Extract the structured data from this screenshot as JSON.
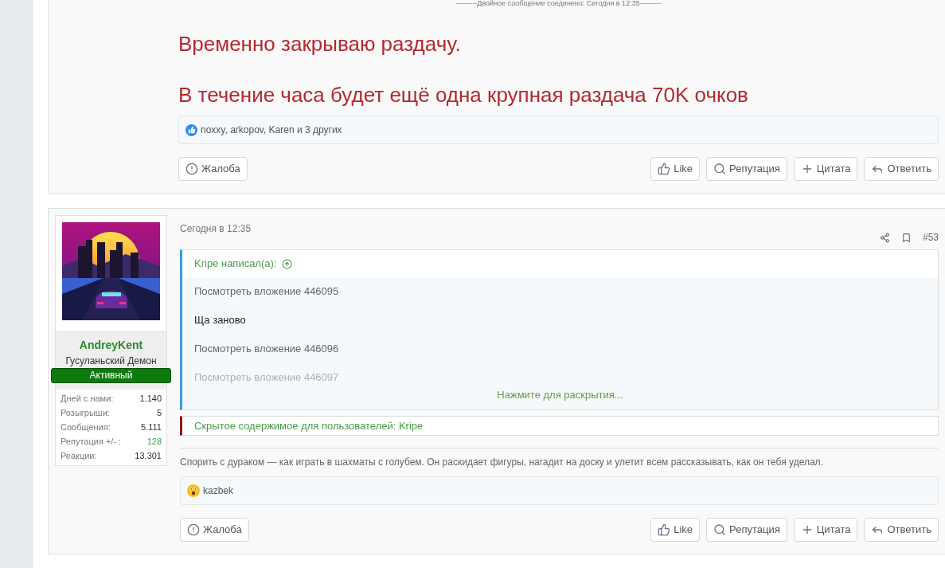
{
  "top_post": {
    "merged_note": "---------Двойное сообщение соединено: Сегодня в 12:35---------",
    "message": [
      "Временно закрываю раздачу.",
      "В течение часа будет ещё одна крупная раздача 70K очков"
    ],
    "reactions": {
      "kind": "like",
      "text": "noxxy, arkopov, Karen и 3 других"
    },
    "report": {
      "kind": "report",
      "label": "Жалоба"
    },
    "actions": [
      {
        "kind": "like",
        "label": "Like"
      },
      {
        "kind": "reputation",
        "label": "Репутация"
      },
      {
        "kind": "quote",
        "label": "Цитата"
      },
      {
        "kind": "reply",
        "label": "Ответить"
      }
    ]
  },
  "post": {
    "author": {
      "name": "AndreyKent",
      "title": "Гусуланьский Демон",
      "badge": "Активный",
      "stats": [
        {
          "label": "Дней с нами:",
          "value": "1.140",
          "highlight": false
        },
        {
          "label": "Розыгрыши:",
          "value": "5",
          "highlight": false
        },
        {
          "label": "Сообщения:",
          "value": "5.111",
          "highlight": false
        },
        {
          "label": "Репутация +/- :",
          "value": "128",
          "highlight": true
        },
        {
          "label": "Реакции:",
          "value": "13.301",
          "highlight": false
        }
      ]
    },
    "date": "Сегодня в 12:35",
    "number": "#53",
    "quote": {
      "author": "Kripe написал(а):",
      "lines": [
        {
          "kind": "attachment",
          "text": "Посмотреть вложение 446095",
          "faded": false
        },
        {
          "kind": "text",
          "text": "Ща заново",
          "faded": false
        },
        {
          "kind": "attachment",
          "text": "Посмотреть вложение 446096",
          "faded": false
        },
        {
          "kind": "attachment",
          "text": "Посмотреть вложение 446097",
          "faded": true
        }
      ],
      "expand": "Нажмите для раскрытия..."
    },
    "hidden": "Скрытое содержимое для пользователей: Kripe",
    "signature": "Спорить с дураком — как играть в шахматы с голубем. Он раскидает фигуры, нагадит на доску и улетит всем рассказывать, как он тебя уделал.",
    "reactions": {
      "kind": "wow",
      "text": "kazbek"
    },
    "report": {
      "kind": "report",
      "label": "Жалоба"
    },
    "actions": [
      {
        "kind": "like",
        "label": "Like"
      },
      {
        "kind": "reputation",
        "label": "Репутация"
      },
      {
        "kind": "quote",
        "label": "Цитата"
      },
      {
        "kind": "reply",
        "label": "Ответить"
      }
    ]
  }
}
